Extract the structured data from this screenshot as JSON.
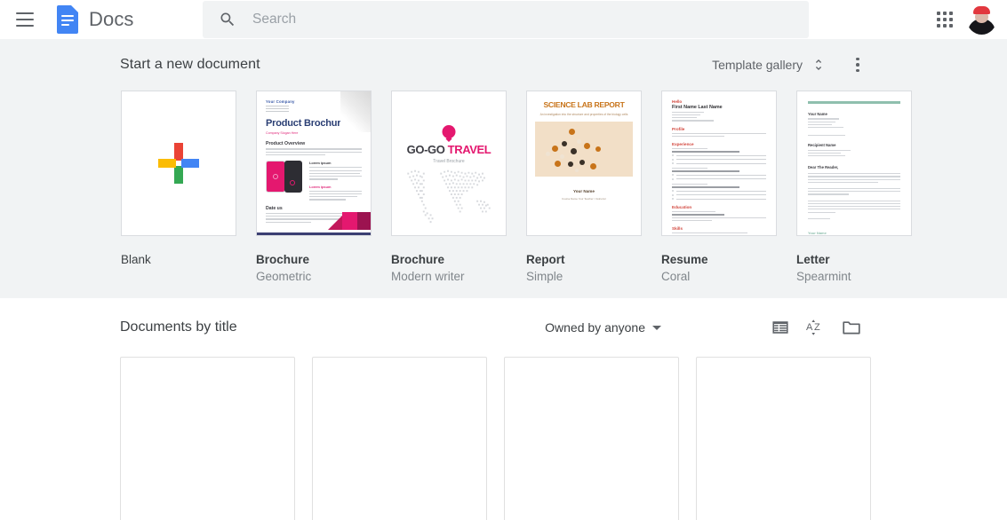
{
  "topbar": {
    "menu_icon": "hamburger-menu-icon",
    "logo_icon": "google-docs-logo",
    "app_title": "Docs",
    "search": {
      "icon": "search-icon",
      "placeholder": "Search",
      "value": ""
    },
    "apps_icon": "google-apps-grid-icon",
    "avatar_icon": "user-avatar"
  },
  "templates": {
    "heading": "Start a new document",
    "gallery_label": "Template gallery",
    "gallery_icon": "unfold-more-icon",
    "more_icon": "more-vert-icon",
    "items": [
      {
        "name": "Blank",
        "sub": "",
        "thumb": "blank-plus"
      },
      {
        "name": "Brochure",
        "sub": "Geometric",
        "thumb": "brochure-geometric"
      },
      {
        "name": "Brochure",
        "sub": "Modern writer",
        "thumb": "brochure-modern-writer"
      },
      {
        "name": "Report",
        "sub": "Simple",
        "thumb": "report-simple"
      },
      {
        "name": "Resume",
        "sub": "Coral",
        "thumb": "resume-coral"
      },
      {
        "name": "Letter",
        "sub": "Spearmint",
        "thumb": "letter-spearmint"
      }
    ]
  },
  "brochure_geometric": {
    "company": "Your Company",
    "title": "Product Brochure",
    "pink_line": "Company Slogan Here",
    "section": "Product Overview",
    "col_head": "Lorem ipsum",
    "col_head_pink": "Lorem ipsum",
    "bottom_section": "Date us"
  },
  "brochure_modern_writer": {
    "brand_left": "GO-GO ",
    "brand_right": "TRAVEL",
    "subtitle": "Travel Brochure"
  },
  "report_simple": {
    "title": "SCIENCE LAB REPORT",
    "subtitle": "An investigation into the structure and properties of the biology cells",
    "author": "Your Name",
    "meta": "Course Name\nYour Teacher / Instructor"
  },
  "resume_coral": {
    "header": "Hello",
    "name": "First Name Last Name",
    "sections": [
      "Profile",
      "Experience",
      "Education",
      "Skills"
    ]
  },
  "letter_spearmint": {
    "sender": "Your Name",
    "recipient": "Recipient Name",
    "salutation": "Dear The Reader,",
    "signoff": "Your Name"
  },
  "documents": {
    "heading": "Documents by title",
    "owner_filter": "Owned by anyone",
    "owner_caret_icon": "arrow-drop-down-icon",
    "list_view_icon": "list-view-icon",
    "sort_icon": "sort-az-icon",
    "folder_icon": "folder-icon",
    "cards": [
      {
        "title": ""
      },
      {
        "title": ""
      },
      {
        "title": ""
      },
      {
        "title": ""
      }
    ]
  },
  "colors": {
    "brand_blue": "#4285f4",
    "band_bg": "#f1f3f4",
    "text_primary": "#3c4043",
    "text_secondary": "#80868b",
    "google_red": "#ea4335",
    "google_yellow": "#fbbc04",
    "google_green": "#34a853",
    "geometric_pink": "#e4186f",
    "report_orange": "#c8741a",
    "coral": "#d2483f",
    "spearmint": "#8fbfae"
  }
}
